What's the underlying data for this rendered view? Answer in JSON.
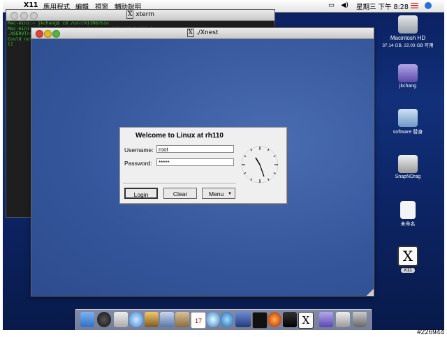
{
  "menubar": {
    "app_name": "X11",
    "items": [
      "應用程式",
      "編輯",
      "視窗",
      "輔助說明"
    ],
    "clock": "星期三 下午 8:28"
  },
  "xterm": {
    "title": "xterm",
    "lines": [
      "Mac-mini:~ jkchang$ cd /usr/X11R6/bin",
      "Mac-mini:/ jkchang$ ./Xnest :1 -query 192.168.1.110 &",
      ".XSERVTra",
      "Could not",
      "[]"
    ]
  },
  "xnest": {
    "title": "./Xnest"
  },
  "login": {
    "heading": "Welcome to Linux at rh110",
    "username_label": "Username:",
    "username_value": "root",
    "password_label": "Password:",
    "password_value": "*****",
    "login_button": "Login",
    "clear_button": "Clear",
    "menu_button": "Menu"
  },
  "desktop": {
    "icons": [
      {
        "label": "Macintosh HD",
        "sub": "37.14 GB, 22.03 GB 可用",
        "color": "#b8bcc4"
      },
      {
        "label": "jkchang",
        "sub": "",
        "color": "#7a6bc4"
      },
      {
        "label": "software 替身",
        "sub": "",
        "color": "#8fb4d8"
      },
      {
        "label": "SnapNDrag",
        "sub": "",
        "color": "#c9c9c9"
      },
      {
        "label": "未命名",
        "sub": "",
        "color": "#e8e8e8"
      },
      {
        "label": "X11",
        "sub": "",
        "color": "#f4f4f4"
      }
    ]
  },
  "dock": {
    "icons": [
      "finder-icon",
      "dashboard-icon",
      "mail-icon",
      "safari-icon",
      "iphoto-icon",
      "address-book-icon",
      "ical-icon",
      "itunes-icon",
      "quicktime-icon",
      "system-prefs-icon",
      "terminal-icon",
      "firefox-icon",
      "activity-monitor-icon",
      "x11-icon",
      "user-icon",
      "documents-icon",
      "trash-icon"
    ],
    "calendar_day": "17"
  },
  "watermark": "#226944",
  "colors": {
    "desktop_bg": "#12307a",
    "terminal_text": "#2ecc2e",
    "login_bg": "#efefef"
  }
}
